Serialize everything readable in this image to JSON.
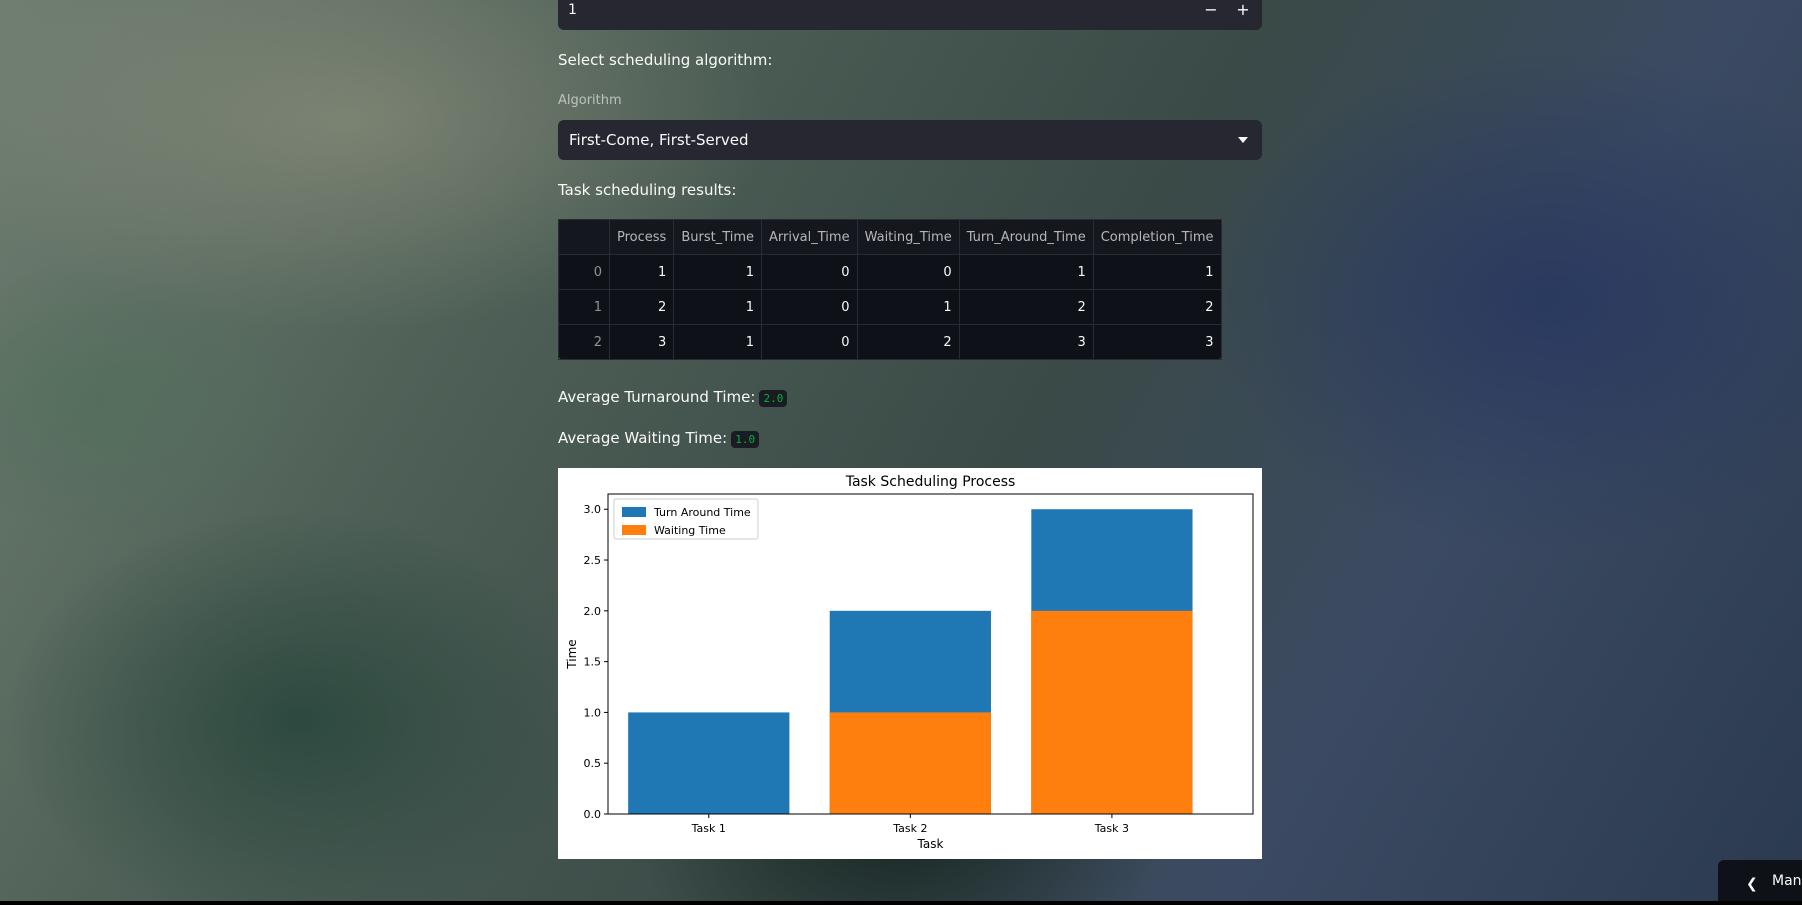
{
  "number_input": {
    "value": "1",
    "minus": "−",
    "plus": "+"
  },
  "scheduling_prompt": "Select scheduling algorithm:",
  "algorithm": {
    "label": "Algorithm",
    "selected": "First-Come, First-Served"
  },
  "results_heading": "Task scheduling results:",
  "table": {
    "columns": [
      "",
      "Process",
      "Burst_Time",
      "Arrival_Time",
      "Waiting_Time",
      "Turn_Around_Time",
      "Completion_Time"
    ],
    "rows": [
      [
        "0",
        "1",
        "1",
        "0",
        "0",
        "1",
        "1"
      ],
      [
        "1",
        "2",
        "1",
        "0",
        "1",
        "2",
        "2"
      ],
      [
        "2",
        "3",
        "1",
        "0",
        "2",
        "3",
        "3"
      ]
    ]
  },
  "avg_turnaround": {
    "label": "Average Turnaround Time:",
    "value": "2.0"
  },
  "avg_waiting": {
    "label": "Average Waiting Time:",
    "value": "1.0"
  },
  "chart_data": {
    "type": "bar",
    "title": "Task Scheduling Process",
    "xlabel": "Task",
    "ylabel": "Time",
    "categories": [
      "Task 1",
      "Task 2",
      "Task 3"
    ],
    "series": [
      {
        "name": "Turn Around Time",
        "values": [
          1,
          2,
          3
        ],
        "color": "#1f77b4"
      },
      {
        "name": "Waiting Time",
        "values": [
          0,
          1,
          2
        ],
        "color": "#ff7f0e"
      }
    ],
    "ylim": [
      0,
      3.15
    ],
    "yticks": [
      "0.0",
      "0.5",
      "1.0",
      "1.5",
      "2.0",
      "2.5",
      "3.0"
    ],
    "legend": "top-left",
    "grid": false
  },
  "manage_button": {
    "label": "Manage app"
  }
}
